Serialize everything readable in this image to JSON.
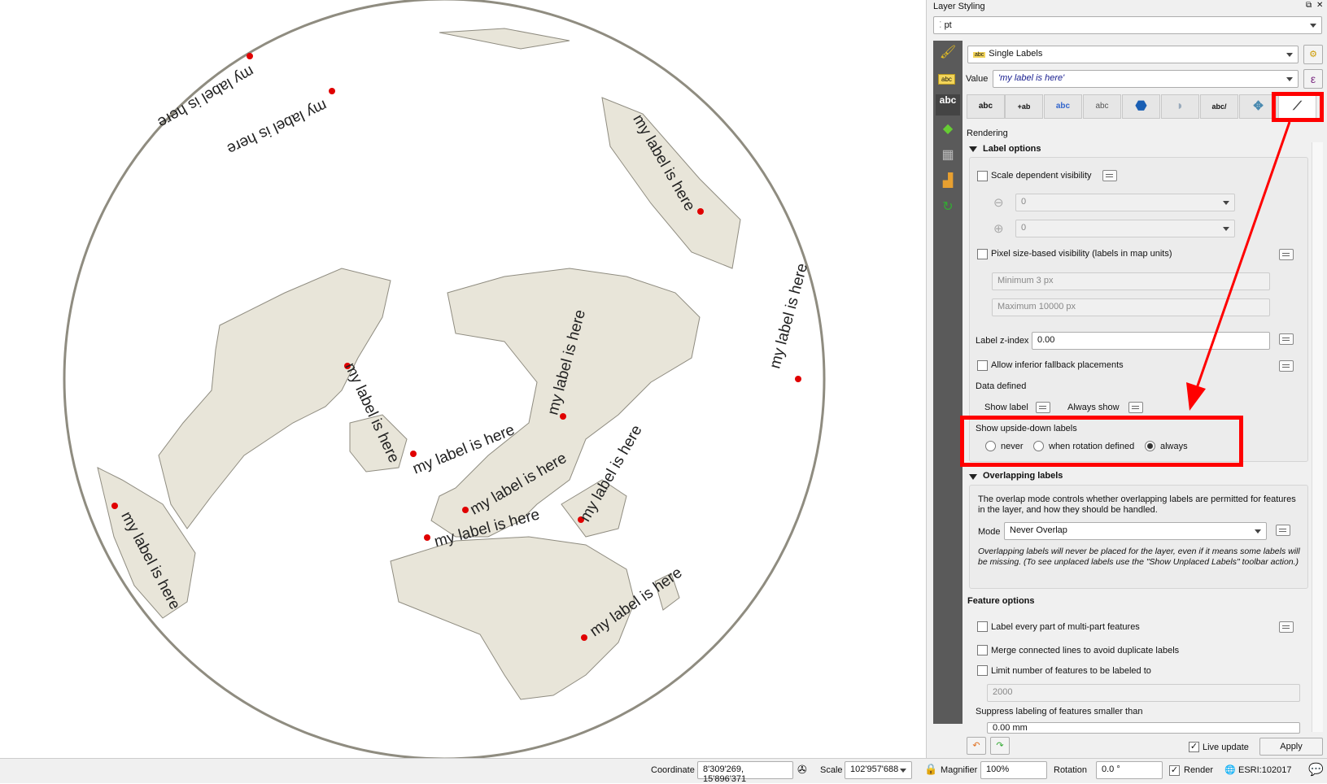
{
  "map": {
    "label_text": "my label is here",
    "labels": [
      {
        "text": "my label is here"
      },
      {
        "text": "my label is here"
      },
      {
        "text": "my label is here"
      },
      {
        "text": "my label is here"
      },
      {
        "text": "my label is here"
      },
      {
        "text": "my label is here"
      },
      {
        "text": "my label is here"
      },
      {
        "text": "my label is here"
      },
      {
        "text": "my label is here"
      },
      {
        "text": "my label is here"
      },
      {
        "text": "my label is here"
      },
      {
        "text": "my label is here"
      }
    ],
    "colors": {
      "land": "#e8e5d9",
      "outline": "#8f8c80",
      "point": "#e00000"
    }
  },
  "panel": {
    "title": "Layer Styling",
    "layer": "pt",
    "renderer": "Single Labels",
    "value_label": "Value",
    "value_expr": "'my label is here'",
    "tabs": [
      "text",
      "formatting",
      "buffer",
      "background",
      "mask",
      "shadow",
      "callouts",
      "placement",
      "rendering"
    ],
    "section_heading": "Rendering",
    "label_options": {
      "heading": "Label options",
      "scale_visibility": "Scale dependent visibility",
      "min_scale": "0",
      "max_scale": "0",
      "pixel_visibility": "Pixel size-based visibility (labels in map units)",
      "min_px": "Minimum 3 px",
      "max_px": "Maximum 10000 px",
      "z_index_label": "Label z-index",
      "z_index": "0.00",
      "fallback": "Allow inferior fallback placements",
      "data_defined": "Data defined",
      "show_label": "Show label",
      "always_show": "Always show",
      "upside_down": "Show upside-down labels",
      "upside_options": [
        "never",
        "when rotation defined",
        "always"
      ],
      "upside_selected": "always"
    },
    "overlap": {
      "heading": "Overlapping labels",
      "desc": "The overlap mode controls whether overlapping labels are permitted for features in the layer, and how they should be handled.",
      "mode_label": "Mode",
      "mode": "Never Overlap",
      "note": "Overlapping labels will never be placed for the layer, even if it means some labels will be missing. (To see unplaced labels use the \"Show Unplaced Labels\" toolbar action.)"
    },
    "feature": {
      "heading": "Feature options",
      "multipart": "Label every part of multi-part features",
      "merge": "Merge connected lines to avoid duplicate labels",
      "limit": "Limit number of features to be labeled to",
      "limit_value": "2000",
      "suppress": "Suppress labeling of features smaller than",
      "suppress_value": "0.00 mm"
    },
    "live_update": "Live update",
    "live_update_checked": true,
    "apply": "Apply"
  },
  "status": {
    "coordinate_label": "Coordinate",
    "coordinate": "8'309'269, 15'896'371",
    "scale_label": "Scale",
    "scale": "102'957'688",
    "magnifier_label": "Magnifier",
    "magnifier": "100%",
    "rotation_label": "Rotation",
    "rotation": "0.0 °",
    "render_label": "Render",
    "render_checked": true,
    "crs": "ESRI:102017"
  }
}
